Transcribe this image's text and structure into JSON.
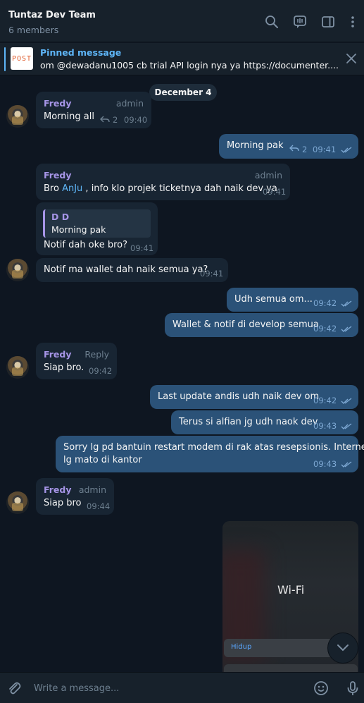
{
  "header": {
    "title": "Tuntaz Dev Team",
    "subtitle": "6 members",
    "icons": [
      "search-icon",
      "video-chat-icon",
      "sidebar-toggle-icon",
      "more-vertical-icon"
    ]
  },
  "pinned": {
    "label": "Pinned message",
    "thumb_text": "POST",
    "text": "om @dewadanu1005 cb trial API login nya ya  https://documenter...."
  },
  "chat": {
    "date": "December 4",
    "messages": [
      {
        "dir": "in",
        "name": "Fredy",
        "role": "admin",
        "text": "Morning all",
        "reply_count": "2",
        "time": "09:40"
      },
      {
        "dir": "out",
        "text": "Morning pak",
        "reply_count": "2",
        "time": "09:41"
      },
      {
        "dir": "in",
        "name": "Fredy",
        "role": "admin",
        "text_before": "Bro ",
        "mention": "AnJu",
        "text_after": " , info klo projek ticketnya dah naik dev ya",
        "time": "09:41"
      },
      {
        "dir": "in",
        "quote_name": "D D",
        "quote_text": "Morning pak",
        "text": "Notif dah oke bro?",
        "time": "09:41"
      },
      {
        "dir": "in",
        "text": "Notif ma wallet dah naik semua ya?",
        "time": "09:41"
      },
      {
        "dir": "out",
        "text": "Udh semua om...",
        "time": "09:42"
      },
      {
        "dir": "out",
        "text": "Wallet & notif di develop semua",
        "time": "09:42"
      },
      {
        "dir": "in",
        "name": "Fredy",
        "role": "Reply",
        "text": "Siap bro.",
        "time": "09:42"
      },
      {
        "dir": "out",
        "text": "Last update andis udh naik dev om",
        "time": "09:42"
      },
      {
        "dir": "out",
        "text": "Terus si alfian jg udh naok dev",
        "time": "09:43"
      },
      {
        "dir": "out",
        "line1": "Sorry lg pd bantuin restart modem di rak atas resepsionis. Internet",
        "line2": "lg mato di kantor",
        "time": "09:43"
      },
      {
        "dir": "in",
        "name": "Fredy",
        "role": "admin",
        "text": "Siap bro",
        "time": "09:44"
      }
    ],
    "image": {
      "title": "Wi-Fi",
      "status": "Hidup"
    }
  },
  "composer": {
    "placeholder": "Write a message...",
    "icons": [
      "attach-icon",
      "emoji-icon",
      "microphone-icon"
    ]
  },
  "colors": {
    "background": "#0e1621",
    "panel": "#17212b",
    "incoming_bubble": "#182533",
    "outgoing_bubble": "#2b5278",
    "accent": "#5eb5f7",
    "sender_name": "#a695e7"
  }
}
